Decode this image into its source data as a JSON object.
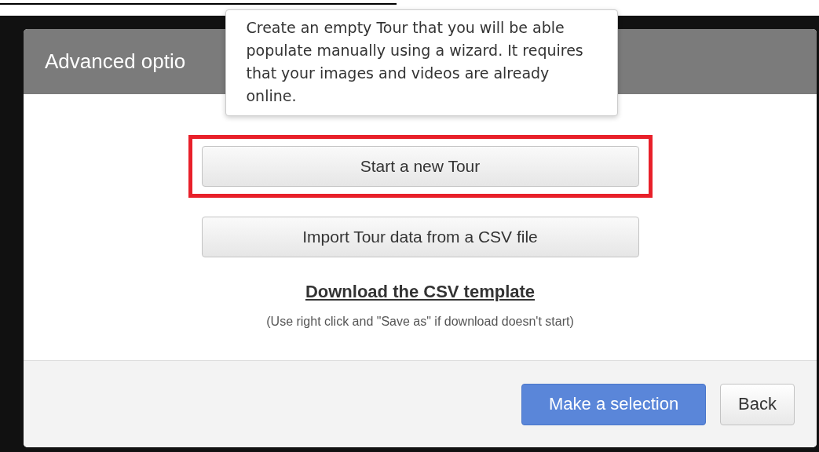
{
  "dialog": {
    "title": "Advanced optio",
    "tooltip": "Create an empty Tour that you will be able populate manually using a wizard. It requires that your images and videos are already online.",
    "buttons": [
      {
        "label": "Start a new Tour",
        "highlighted": true
      },
      {
        "label": "Import Tour data from a CSV file",
        "highlighted": false
      }
    ],
    "link": "Download the CSV template",
    "note": "(Use right click and \"Save as\" if download doesn't start)",
    "footer_buttons": [
      {
        "label": "Make a selection",
        "kind": "primary"
      },
      {
        "label": "Back",
        "kind": "default"
      }
    ]
  }
}
